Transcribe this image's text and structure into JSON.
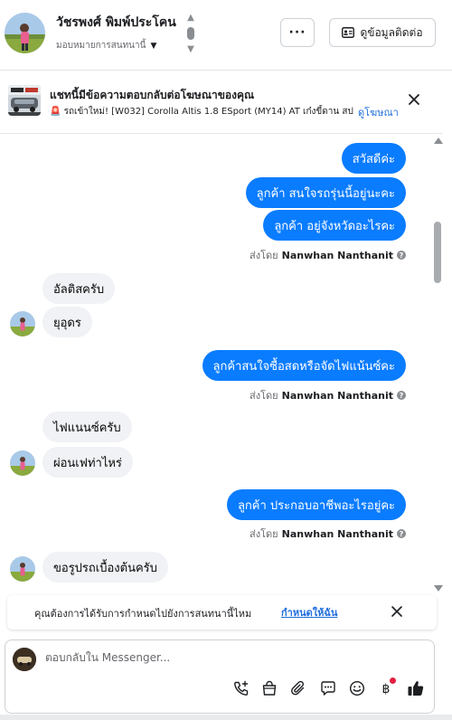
{
  "header": {
    "contact_name": "วัชรพงศ์ พิมพ์ประโคน",
    "assign_label": "มอบหมายการสนทนานี้",
    "more_label": "···",
    "contact_info_label": "ดูข้อมูลติดต่อ"
  },
  "ad_banner": {
    "title": "แชทนี้มีข้อความตอบกลับต่อโฆษณาของคุณ",
    "subtitle": "🚨 รถเข้าใหม่! [W032] Corolla Altis 1.8 ESport (MY14) AT เก๋งขี้ดาน สป...",
    "link": "ดูโฆษณา"
  },
  "messages": {
    "m1": "สวัสดีค่ะ",
    "m2": "ลูกค้า สนใจรถรุ่นนี้อยู่นะคะ",
    "m3": "ลูกค้า อยู่จังหวัดอะไรคะ",
    "m4": "อัลติสครับ",
    "m5": "ยุอุดร",
    "m6": "ลูกค้าสนใจซื้อสดหรือจัดไฟแน้นซ์คะ",
    "m7": "ไฟแนนซ์ครับ",
    "m8": "ผ่อนเฟท่าไหร่",
    "m9": "ลูกค้า ประกอบอาชีพอะไรอยู่คะ",
    "m10": "ขอรูปรถเบื้องต้นครับ"
  },
  "sent_by": {
    "prefix": "ส่งโดย",
    "name": "Nanwhan Nanthanit"
  },
  "reminder": {
    "text": "คุณต้องการได้รับการกำหนดไปยังการสนทนานี้ไหม",
    "link": "กำหนดให้ฉัน"
  },
  "composer": {
    "placeholder": "ตอบกลับใน Messenger..."
  },
  "colors": {
    "outgoing_bubble": "#0a7cff",
    "incoming_bubble": "#f0f2f5",
    "link": "#216fdb"
  },
  "icons": [
    "navigation-arrows-icon",
    "more-icon",
    "contact-card-icon",
    "close-icon",
    "help-icon",
    "add-call-icon",
    "shopping-bag-icon",
    "attachment-icon",
    "saved-reply-icon",
    "emoji-icon",
    "baht-payment-icon",
    "thumbs-up-icon"
  ]
}
